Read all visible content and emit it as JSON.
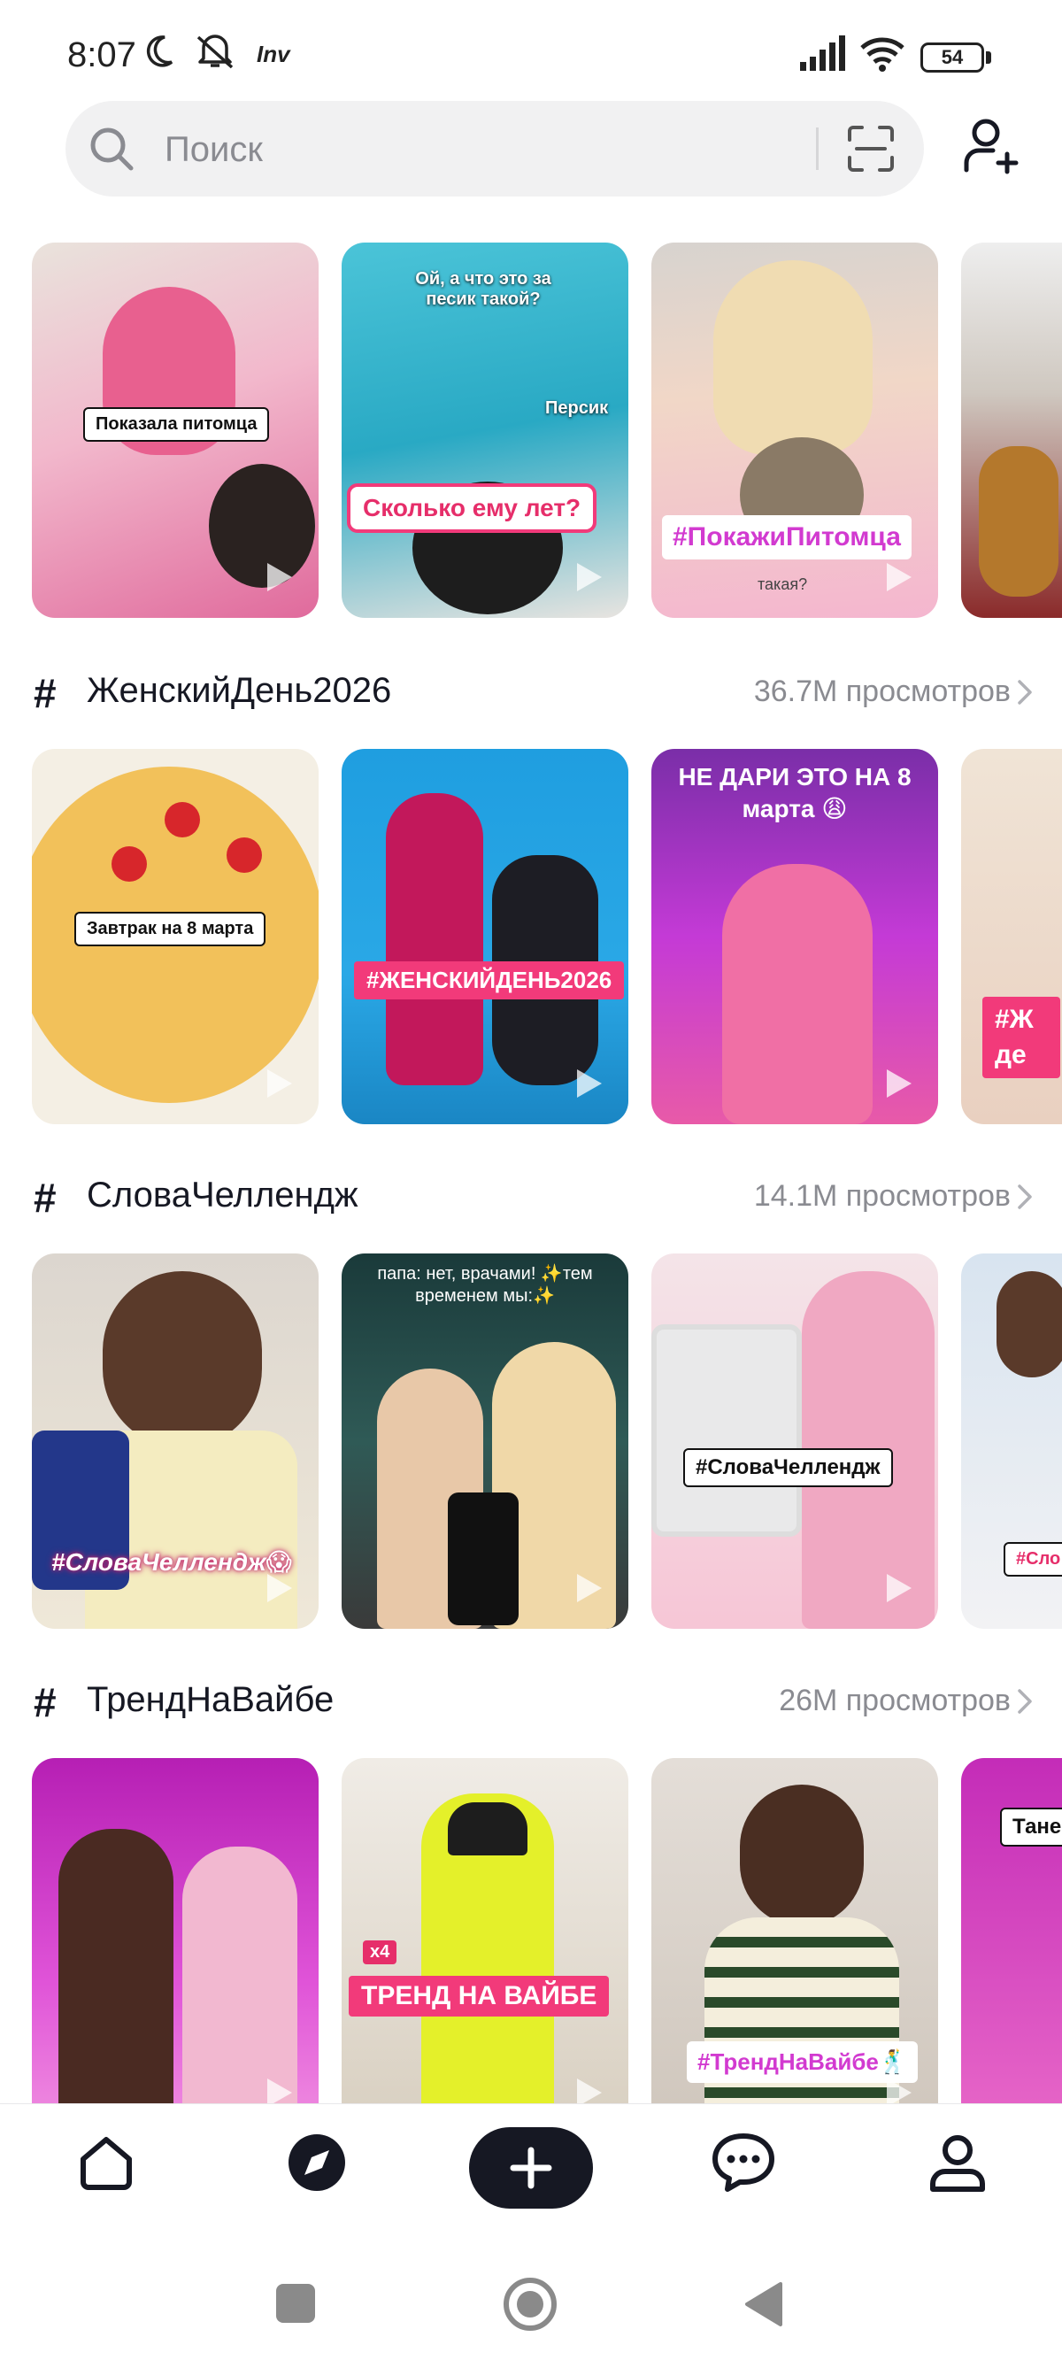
{
  "status_bar": {
    "time": "8:07",
    "left_icons": [
      "moon-icon",
      "mute-icon",
      "inv-icon"
    ],
    "inv_label": "Inv",
    "battery": "54"
  },
  "search": {
    "placeholder": "Поиск"
  },
  "sections": [
    {
      "id": "trending",
      "thumbnails": [
        {
          "caption": "Показала питомца",
          "caption_style": "white"
        },
        {
          "top_text": "Ой, а что это за песик такой?",
          "side_text": "Персик",
          "caption": "Сколько ему лет?",
          "caption_style": "pink"
        },
        {
          "caption": "#ПокажиПитомца",
          "caption_style": "grad",
          "bottom_text": "такая?"
        },
        {
          "caption": "",
          "caption_style": "none"
        }
      ]
    },
    {
      "id": "womens-day",
      "hashtag": "ЖенскийДень2026",
      "views": "36.7M просмотров",
      "thumbnails": [
        {
          "caption": "Завтрак на 8 марта",
          "caption_style": "white"
        },
        {
          "caption": "#ЖЕНСКИЙДЕНЬ2026",
          "caption_style": "magenta"
        },
        {
          "top_text": "НЕ ДАРИ ЭТО НА 8 марта 😩",
          "caption": "",
          "caption_style": "none"
        },
        {
          "caption": "#Ж де",
          "caption_style": "magenta"
        }
      ]
    },
    {
      "id": "words-challenge",
      "hashtag": "СловаЧеллендж",
      "views": "14.1M просмотров",
      "thumbnails": [
        {
          "caption": "#СловаЧеллендж😱",
          "caption_style": "italic"
        },
        {
          "top_text": "папа: нет, врачами! ✨тем временем мы:✨",
          "caption": "",
          "caption_style": "none"
        },
        {
          "caption": "#СловаЧеллендж",
          "caption_style": "white"
        },
        {
          "caption": "#Сло",
          "caption_style": "white"
        }
      ]
    },
    {
      "id": "vibe-trend",
      "hashtag": "ТрендНаВайбе",
      "views": "26M просмотров",
      "thumbnails": [
        {
          "caption": "",
          "caption_style": "none"
        },
        {
          "badge": "x4",
          "caption": "ТРЕНД НА ВАЙБЕ",
          "caption_style": "magenta"
        },
        {
          "caption": "#ТрендНаВайбе🕺",
          "caption_style": "grad"
        },
        {
          "caption": "Тане",
          "caption_style": "white"
        }
      ]
    }
  ],
  "bottom_nav": {
    "items": [
      "home-icon",
      "discover-icon",
      "create-icon",
      "inbox-icon",
      "profile-icon"
    ]
  },
  "system_nav": [
    "recents-icon",
    "home-circle-icon",
    "back-icon"
  ],
  "colors": {
    "accent_pink": "#f23a7a",
    "text_primary": "#161823",
    "text_secondary": "#8a8b91",
    "search_bg": "#f1f1f2"
  }
}
